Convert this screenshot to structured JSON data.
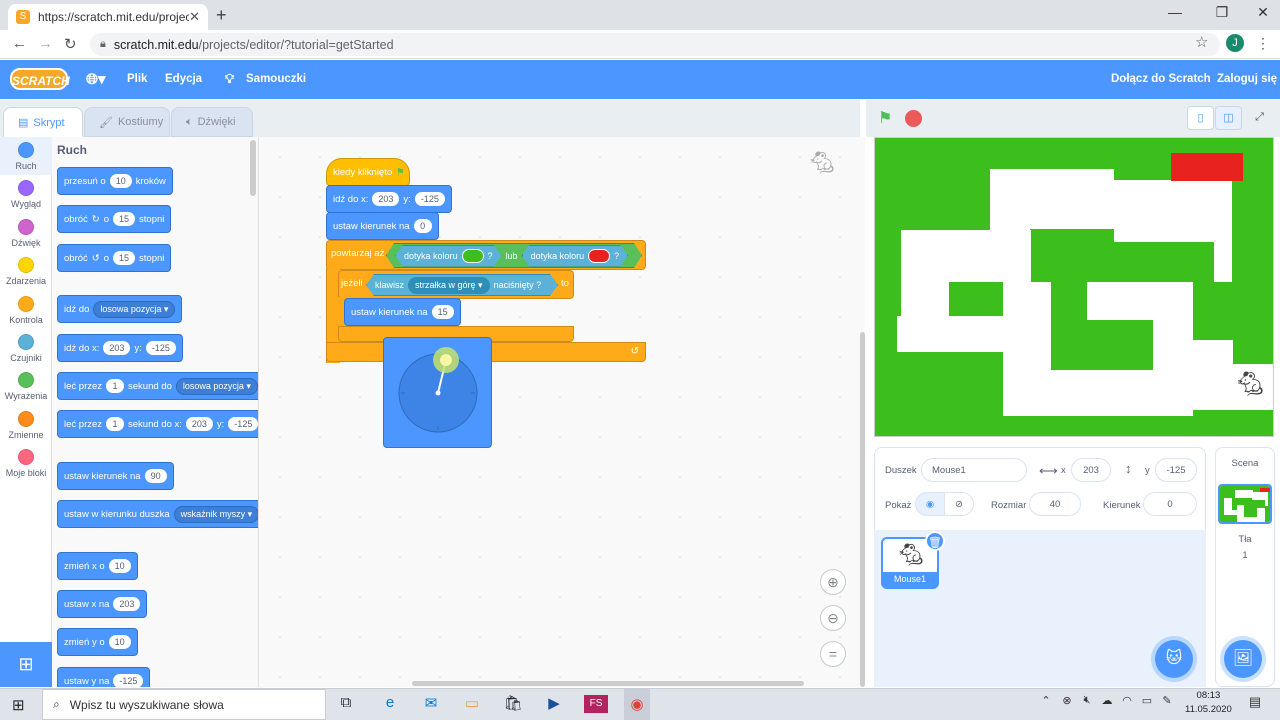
{
  "browser": {
    "tab_title": "https://scratch.mit.edu/projects/e",
    "url_host": "scratch.mit.edu",
    "url_path": "/projects/editor/?tutorial=getStarted",
    "avatar": "J"
  },
  "menubar": {
    "logo": "SCRATCH",
    "file": "Plik",
    "edit": "Edycja",
    "tutorials": "Samouczki",
    "join": "Dołącz do Scratch",
    "signin": "Zaloguj się"
  },
  "tabs": {
    "code": "Skrypt",
    "costumes": "Kostiumy",
    "sounds": "Dźwięki"
  },
  "categories": [
    {
      "label": "Ruch",
      "color": "#4c97ff"
    },
    {
      "label": "Wygląd",
      "color": "#9966ff"
    },
    {
      "label": "Dźwięk",
      "color": "#cf63cf"
    },
    {
      "label": "Zdarzenia",
      "color": "#ffd500"
    },
    {
      "label": "Kontrola",
      "color": "#ffab19"
    },
    {
      "label": "Czujniki",
      "color": "#5cb1d6"
    },
    {
      "label": "Wyrażenia",
      "color": "#59c059"
    },
    {
      "label": "Zmienne",
      "color": "#ff8c1a"
    },
    {
      "label": "Moje bloki",
      "color": "#ff6680"
    }
  ],
  "palette": {
    "heading": "Ruch",
    "move": {
      "a": "przesuń o",
      "v": "10",
      "b": "kroków"
    },
    "turn_right": {
      "a": "obróć",
      "b": "o",
      "v": "15",
      "c": "stopni"
    },
    "turn_left": {
      "a": "obróć",
      "b": "o",
      "v": "15",
      "c": "stopni"
    },
    "goto": {
      "a": "idź do",
      "dd": "losowa pozycja"
    },
    "goto_xy": {
      "a": "idź do x:",
      "x": "203",
      "b": "y:",
      "y": "-125"
    },
    "glide": {
      "a": "leć przez",
      "v": "1",
      "b": "sekund do",
      "dd": "losowa pozycja"
    },
    "glide_xy": {
      "a": "leć przez",
      "v": "1",
      "b": "sekund do x:",
      "x": "203",
      "c": "y:",
      "y": "-125"
    },
    "point_dir": {
      "a": "ustaw kierunek na",
      "v": "90"
    },
    "point_towards": {
      "a": "ustaw w kierunku duszka",
      "dd": "wskaźnik myszy"
    },
    "change_x": {
      "a": "zmień x o",
      "v": "10"
    },
    "set_x": {
      "a": "ustaw x na",
      "v": "203"
    },
    "change_y": {
      "a": "zmień y o",
      "v": "10"
    },
    "set_y": {
      "a": "ustaw y na",
      "v": "-125"
    }
  },
  "script": {
    "hat": "kiedy kliknięto",
    "goto": {
      "a": "idź do x:",
      "x": "203",
      "b": "y:",
      "y": "-125"
    },
    "dir": {
      "a": "ustaw kierunek na",
      "v": "0"
    },
    "repeat": {
      "a": "powtarzaj aż",
      "c1": "dotyka koloru",
      "q1": "?",
      "or": "lub",
      "c2": "dotyka koloru",
      "q2": "?",
      "col1": "#3cbf1c",
      "col2": "#e8231f"
    },
    "if": {
      "a": "jeżeli",
      "k": "klawisz",
      "dd": "strzałka w górę",
      "b": "naciśnięty ?",
      "c": "to"
    },
    "inner": {
      "a": "ustaw kierunek na",
      "v": "15"
    }
  },
  "stage_maze": {
    "green": "#3cbf1c",
    "white": "#ffffff",
    "goal": "#e8231f"
  },
  "sprite_info": {
    "sprite_label": "Duszek",
    "sprite_name": "Mouse1",
    "x_label": "x",
    "x": "203",
    "y_label": "y",
    "y": "-125",
    "show_label": "Pokaż",
    "size_label": "Rozmiar",
    "size": "40",
    "dir_label": "Kierunek",
    "dir": "0"
  },
  "sprites": [
    {
      "name": "Mouse1"
    }
  ],
  "scene": {
    "title": "Scena",
    "bg_label": "Tła",
    "bg_count": "1"
  },
  "taskbar": {
    "search": "Wpisz tu wyszukiwane słowa",
    "time": "08:13",
    "date": "11.05.2020",
    "fs": "FS"
  }
}
